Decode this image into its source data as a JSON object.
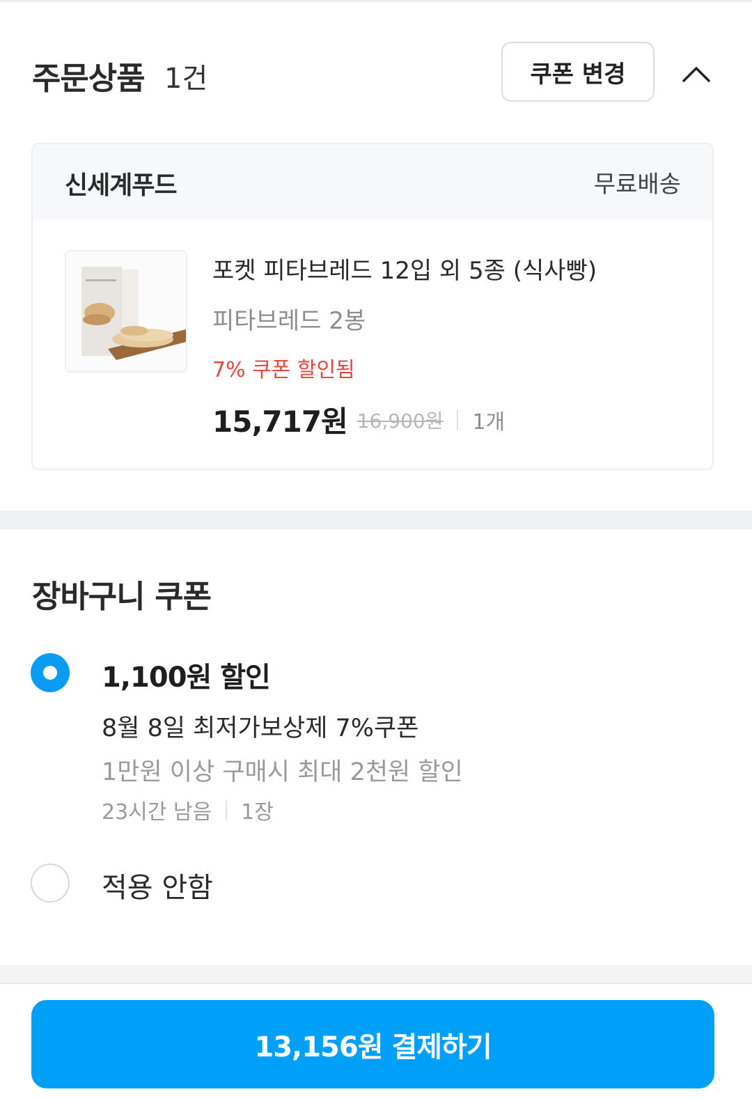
{
  "order": {
    "title": "주문상품",
    "count": "1건",
    "coupon_change_label": "쿠폰 변경",
    "collapse_icon": "chevron-up-icon"
  },
  "seller": {
    "name": "신세계푸드",
    "shipping": "무료배송"
  },
  "product": {
    "name": "포켓 피타브레드 12입 외 5종 (식사빵)",
    "option": "피타브레드 2봉",
    "discount_note": "7% 쿠폰 할인됨",
    "final_price": "15,717원",
    "original_price": "16,900원",
    "quantity": "1개"
  },
  "cart_coupon": {
    "title": "장바구니 쿠폰",
    "options": [
      {
        "amount": "1,100원 할인",
        "name": "8월 8일 최저가보상제 7%쿠폰",
        "condition": "1만원 이상 구매시 최대 2천원 할인",
        "remaining": "23시간 남음",
        "qty": "1장",
        "selected": true
      },
      {
        "label": "적용 안함",
        "selected": false
      }
    ]
  },
  "payment": {
    "button_label": "13,156원 결제하기"
  },
  "colors": {
    "accent": "#00a0f8",
    "radio_selected": "#0a9bf5",
    "discount_red": "#e4473d"
  }
}
